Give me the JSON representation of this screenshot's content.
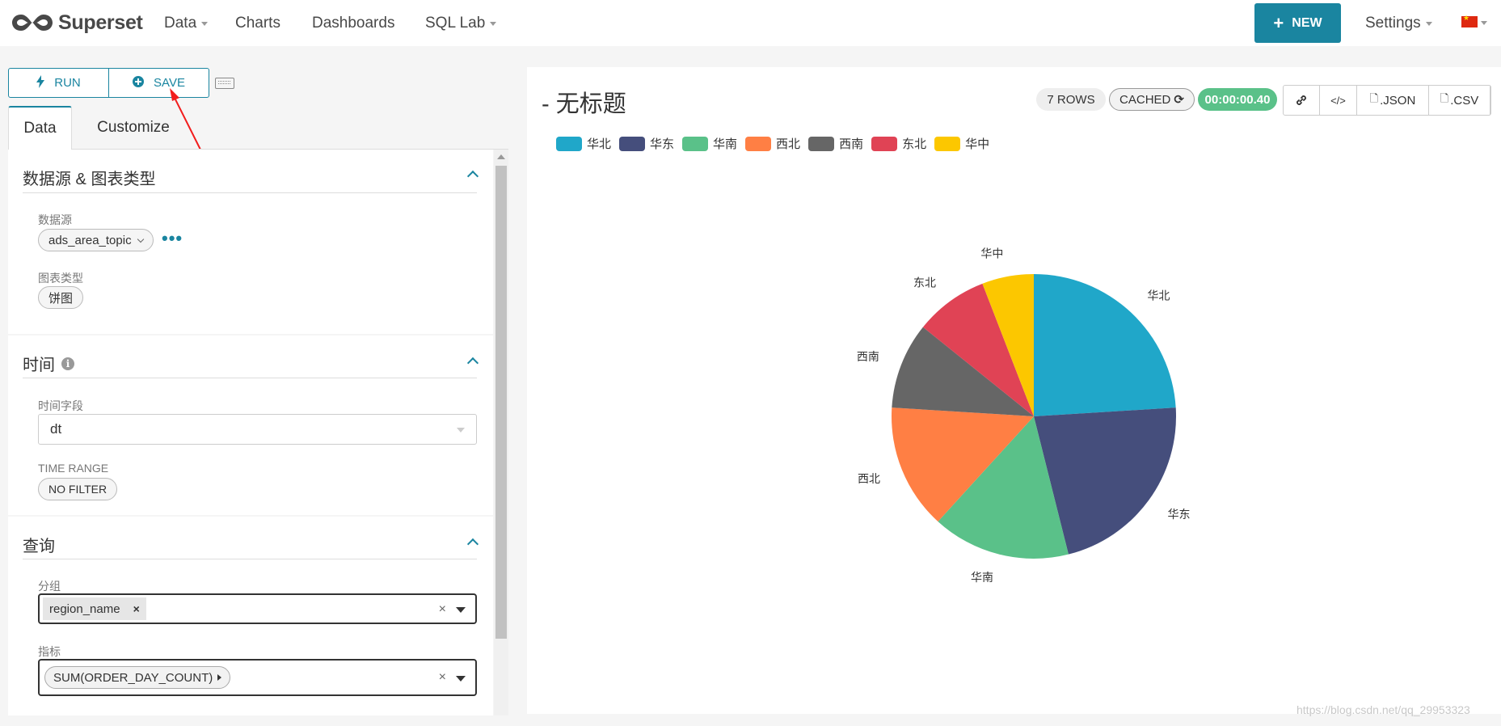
{
  "navbar": {
    "brand": "Superset",
    "items": [
      {
        "label": "Data",
        "dropdown": true
      },
      {
        "label": "Charts",
        "dropdown": false
      },
      {
        "label": "Dashboards",
        "dropdown": false
      },
      {
        "label": "SQL Lab",
        "dropdown": true
      }
    ],
    "new_label": "NEW",
    "settings_label": "Settings"
  },
  "toolbar": {
    "run_label": "RUN",
    "save_label": "SAVE"
  },
  "tabs": {
    "data": "Data",
    "customize": "Customize"
  },
  "sections": {
    "datasource": {
      "title": "数据源 & 图表类型",
      "datasource_label": "数据源",
      "datasource_value": "ads_area_topic",
      "viz_label": "图表类型",
      "viz_value": "饼图"
    },
    "time": {
      "title": "时间",
      "field_label": "时间字段",
      "field_value": "dt",
      "range_label": "TIME RANGE",
      "range_value": "NO FILTER"
    },
    "query": {
      "title": "查询",
      "groupby_label": "分组",
      "groupby_value": "region_name",
      "metric_label": "指标",
      "metric_value": "SUM(ORDER_DAY_COUNT)"
    }
  },
  "chart_header": {
    "title": "- 无标题",
    "rows": "7 ROWS",
    "cached": "CACHED",
    "duration": "00:00:00.40",
    "json": ".JSON",
    "csv": ".CSV"
  },
  "chart_data": {
    "type": "pie",
    "categories": [
      "华北",
      "华东",
      "华南",
      "西北",
      "西南",
      "东北",
      "华中"
    ],
    "values": [
      24.5,
      22.5,
      16.0,
      14.5,
      10.0,
      8.5,
      6.0
    ],
    "colors": [
      "#20a7c9",
      "#454e7c",
      "#5ac189",
      "#ff7f44",
      "#666666",
      "#e04355",
      "#fcc700"
    ],
    "legend": "top-left"
  },
  "watermark": "https://blog.csdn.net/qq_29953323"
}
